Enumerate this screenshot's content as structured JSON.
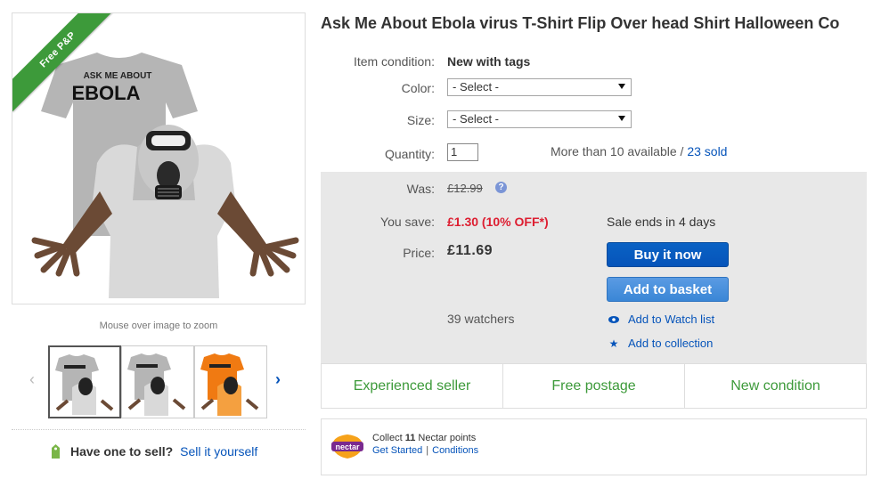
{
  "product": {
    "title": "Ask Me About Ebola virus T-Shirt Flip Over head Shirt Halloween Co",
    "ribbon": "Free P&P",
    "shirt_text_line1": "ASK ME ABOUT",
    "shirt_text_line2": "EBOLA",
    "zoom_hint": "Mouse over image to zoom"
  },
  "selling": {
    "question": "Have one to sell?",
    "link": "Sell it yourself"
  },
  "details": {
    "condition_label": "Item condition:",
    "condition_value": "New with tags",
    "color_label": "Color:",
    "color_value": "- Select -",
    "size_label": "Size:",
    "size_value": "- Select -",
    "quantity_label": "Quantity:",
    "quantity_value": "1",
    "availability": "More than 10 available",
    "sold_separator": " / ",
    "sold": "23 sold"
  },
  "pricing": {
    "was_label": "Was:",
    "was_value": "£12.99",
    "help_glyph": "?",
    "save_label": "You save:",
    "save_value": "£1.30 (10% OFF*)",
    "price_label": "Price:",
    "price_value": "£11.69",
    "sale_ends": "Sale ends in 4 days",
    "buy_now": "Buy it now",
    "add_basket": "Add to basket",
    "watchers": "39 watchers",
    "watch_list": "Add to Watch list",
    "collection": "Add to collection"
  },
  "features": {
    "seller": "Experienced seller",
    "postage": "Free postage",
    "condition": "New condition"
  },
  "nectar": {
    "logo_text": "nectar",
    "collect_pre": "Collect",
    "points": "11",
    "collect_post": "Nectar points",
    "get_started": "Get Started",
    "separator": "|",
    "conditions": "Conditions"
  },
  "colors": {
    "link": "#0654ba",
    "accent_green": "#3d9a3a",
    "discount_red": "#dd1e31",
    "price_panel": "#e8e8e8"
  },
  "icons": [
    "left-arrow-icon",
    "right-arrow-icon",
    "help-icon",
    "eye-icon",
    "star-icon",
    "price-tag-icon",
    "nectar-logo-icon"
  ]
}
